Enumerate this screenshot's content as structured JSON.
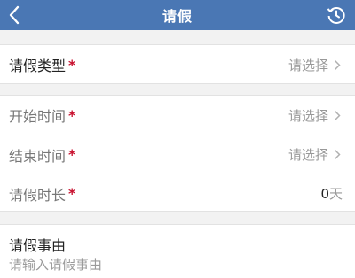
{
  "header": {
    "title": "请假",
    "bg_color": "#4a77b4",
    "back_icon": "chevron-left-icon",
    "history_icon": "clock-history-icon"
  },
  "form": {
    "leave_type": {
      "label": "请假类型",
      "required_mark": "*",
      "value": "请选择"
    },
    "start_time": {
      "label": "开始时间",
      "required_mark": "*",
      "value": "请选择"
    },
    "end_time": {
      "label": "结束时间",
      "required_mark": "*",
      "value": "请选择"
    },
    "duration": {
      "label": "请假时长",
      "required_mark": "*",
      "value": "0",
      "unit": "天"
    },
    "reason": {
      "label": "请假事由",
      "placeholder": "请输入请假事由",
      "value": ""
    }
  },
  "colors": {
    "required": "#c8102e",
    "placeholder": "#999999"
  }
}
